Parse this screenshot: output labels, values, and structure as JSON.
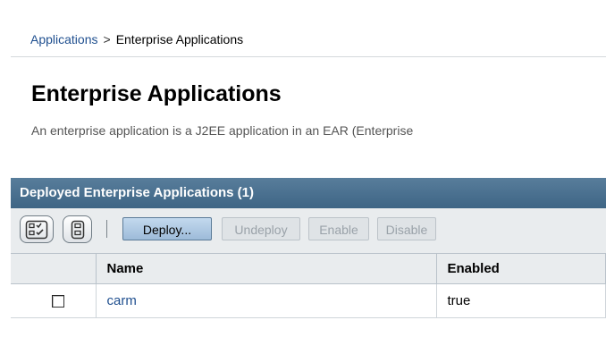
{
  "breadcrumb": {
    "parent": "Applications",
    "separator": ">",
    "current": "Enterprise Applications"
  },
  "page": {
    "title": "Enterprise Applications",
    "description": "An enterprise application is a J2EE application in an EAR (Enterprise"
  },
  "panel": {
    "title": "Deployed Enterprise Applications (1)"
  },
  "toolbar": {
    "select_all_icon": "select-all-icon",
    "deselect_all_icon": "deselect-all-icon",
    "deploy_label": "Deploy...",
    "undeploy_label": "Undeploy",
    "enable_label": "Enable",
    "disable_label": "Disable"
  },
  "table": {
    "columns": [
      "",
      "Name",
      "Enabled"
    ],
    "rows": [
      {
        "selected": false,
        "name": "carm",
        "enabled": "true"
      }
    ]
  },
  "colors": {
    "header_bar": "#4a6f8f",
    "link": "#1f4f8f",
    "toolbar_bg": "#e9ecee"
  }
}
